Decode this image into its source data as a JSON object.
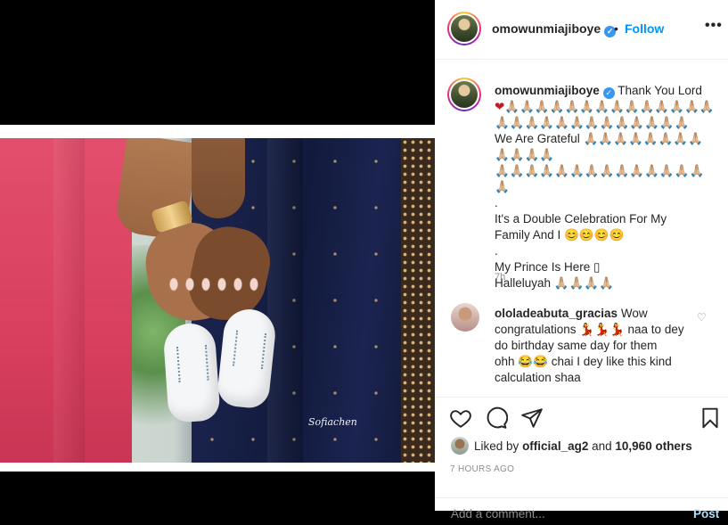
{
  "header": {
    "username": "omowunmiajiboye",
    "verified_icon": "verified-badge-icon",
    "separator": "•",
    "follow_label": "Follow",
    "more_label": "•••"
  },
  "photo": {
    "signature_text": "Sofiachen"
  },
  "caption": {
    "username": "omowunmiajiboye",
    "line1": "Thank You Lord",
    "heart": "❤",
    "emoji_row1": "🙏🏼🙏🏼🙏🏼🙏🏼🙏🏼🙏🏼🙏🏼🙏🏼🙏🏼🙏🏼🙏🏼🙏🏼🙏🏼🙏🏼",
    "emoji_row2": "🙏🏼🙏🏼🙏🏼🙏🏼🙏🏼🙏🏼🙏🏼🙏🏼🙏🏼🙏🏼🙏🏼🙏🏼🙏🏼",
    "line2": "We Are Grateful",
    "emoji_row3": "🙏🏼🙏🏼🙏🏼🙏🏼🙏🏼🙏🏼🙏🏼🙏🏼🙏🏼🙏🏼🙏🏼🙏🏼",
    "emoji_row4": "🙏🏼🙏🏼🙏🏼🙏🏼🙏🏼🙏🏼🙏🏼🙏🏼🙏🏼🙏🏼🙏🏼🙏🏼🙏🏼🙏🏼🙏🏼",
    "dot1": ".",
    "line3": "It's a Double Celebration For My",
    "line4": "Family And I",
    "emoji_smiles": "😊😊😊😊",
    "dot2": ".",
    "line5": "My Prince Is Here",
    "box_glyph": "▯",
    "line6": "Halleluyah",
    "emoji_row5": "🙏🏼🙏🏼🙏🏼🙏🏼",
    "time": "7h"
  },
  "comment": {
    "username": "ololadeabuta_gracias",
    "text_1": "Wow",
    "text_2": "congratulations",
    "dance_emoji": "💃💃💃",
    "text_3": "naa to dey",
    "text_4": "do birthday same day for them",
    "text_5": "ohh",
    "laugh_emoji": "😂😂",
    "text_6": "chai I dey like this kind",
    "text_7": "calculation shaa",
    "like_icon": "heart-outline-icon"
  },
  "actions": {
    "like_icon": "heart-icon",
    "comment_icon": "comment-icon",
    "share_icon": "send-icon",
    "save_icon": "bookmark-icon"
  },
  "likes": {
    "prefix": "Liked by",
    "user": "official_ag2",
    "connector": "and",
    "count_text": "10,960 others"
  },
  "timestamp": "7 HOURS AGO",
  "add_comment": {
    "placeholder": "Add a comment...",
    "post_label": "Post"
  }
}
